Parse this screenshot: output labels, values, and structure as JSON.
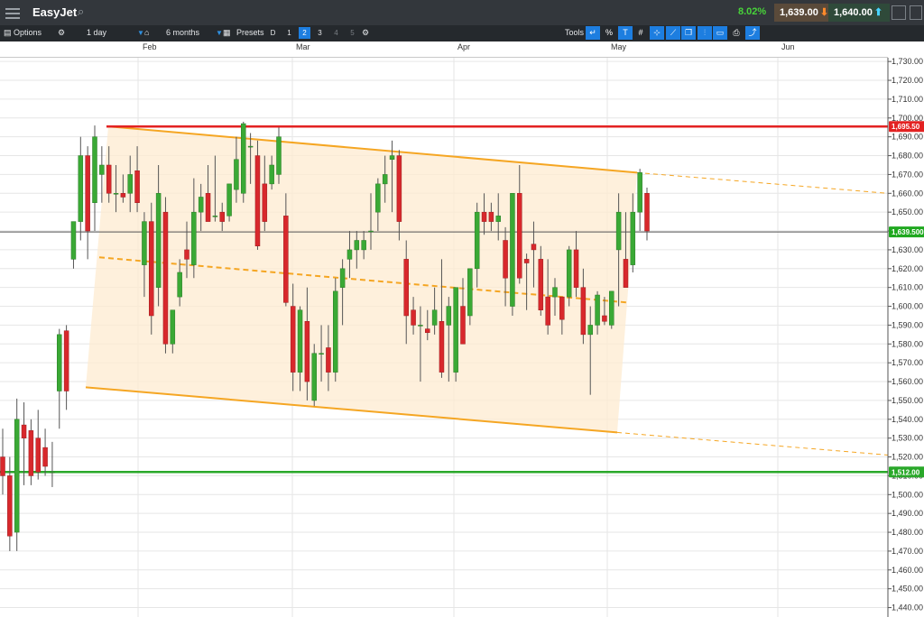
{
  "header": {
    "title": "EasyJet",
    "change": "8.02%",
    "sell_price": "1,639.00",
    "buy_price": "1,640.00"
  },
  "toolbar": {
    "options_label": "Options",
    "interval": "1 day",
    "range": "6 months",
    "presets_label": "Presets",
    "presets": [
      "D",
      "1",
      "2",
      "3",
      "4",
      "5"
    ],
    "active_preset": "2",
    "tools_label": "Tools"
  },
  "colors": {
    "up": "#3aa935",
    "down": "#d8282c",
    "resistance": "#e32222",
    "support": "#2aa82a",
    "channel": "#f5a623",
    "channel_fill": "#fdebd0",
    "current_price": "#1fa81f"
  },
  "chart_data": {
    "type": "candlestick",
    "x_labels": [
      "Feb",
      "Mar",
      "Apr",
      "May",
      "Jun"
    ],
    "ylim": [
      1435,
      1732
    ],
    "y_ticks": [
      1440,
      1450,
      1460,
      1470,
      1480,
      1490,
      1500,
      1510,
      1520,
      1530,
      1540,
      1550,
      1560,
      1570,
      1580,
      1590,
      1600,
      1610,
      1620,
      1630,
      1640,
      1650,
      1660,
      1670,
      1680,
      1690,
      1700,
      1710,
      1720,
      1730
    ],
    "grid": true,
    "resistance": {
      "value": 1695.5,
      "label": "1,695.50"
    },
    "support": {
      "value": 1512.0,
      "label": "1,512.00"
    },
    "current_price": {
      "value": 1639.5,
      "label": "1,639.500"
    },
    "channel": {
      "upper": [
        1695.5,
        1671
      ],
      "middle": [
        1626,
        1602
      ],
      "lower": [
        1557,
        1533
      ],
      "extension_upper": 1660,
      "extension_lower": 1521
    },
    "candles": [
      {
        "o": 1520,
        "h": 1535,
        "l": 1500,
        "c": 1510
      },
      {
        "o": 1510,
        "h": 1520,
        "l": 1470,
        "c": 1478
      },
      {
        "o": 1480,
        "h": 1551,
        "l": 1470,
        "c": 1540
      },
      {
        "o": 1537,
        "h": 1549,
        "l": 1505,
        "c": 1530
      },
      {
        "o": 1534,
        "h": 1540,
        "l": 1505,
        "c": 1510
      },
      {
        "o": 1530,
        "h": 1545,
        "l": 1508,
        "c": 1512
      },
      {
        "o": 1525,
        "h": 1535,
        "l": 1510,
        "c": 1515
      },
      {
        "o": 1512,
        "h": 1528,
        "l": 1504,
        "c": 1512
      },
      {
        "o": 1555,
        "h": 1588,
        "l": 1535,
        "c": 1585
      },
      {
        "o": 1587,
        "h": 1590,
        "l": 1545,
        "c": 1555
      },
      {
        "o": 1625,
        "h": 1645,
        "l": 1620,
        "c": 1645
      },
      {
        "o": 1645,
        "h": 1690,
        "l": 1635,
        "c": 1680
      },
      {
        "o": 1680,
        "h": 1685,
        "l": 1625,
        "c": 1640
      },
      {
        "o": 1655,
        "h": 1696,
        "l": 1640,
        "c": 1690
      },
      {
        "o": 1670,
        "h": 1685,
        "l": 1655,
        "c": 1675
      },
      {
        "o": 1675,
        "h": 1685,
        "l": 1655,
        "c": 1660
      },
      {
        "o": 1660,
        "h": 1675,
        "l": 1650,
        "c": 1660
      },
      {
        "o": 1660,
        "h": 1670,
        "l": 1655,
        "c": 1658
      },
      {
        "o": 1660,
        "h": 1680,
        "l": 1650,
        "c": 1670
      },
      {
        "o": 1672,
        "h": 1685,
        "l": 1650,
        "c": 1655
      },
      {
        "o": 1622,
        "h": 1650,
        "l": 1605,
        "c": 1645
      },
      {
        "o": 1645,
        "h": 1655,
        "l": 1585,
        "c": 1595
      },
      {
        "o": 1610,
        "h": 1675,
        "l": 1600,
        "c": 1660
      },
      {
        "o": 1650,
        "h": 1658,
        "l": 1575,
        "c": 1580
      },
      {
        "o": 1580,
        "h": 1598,
        "l": 1575,
        "c": 1598
      },
      {
        "o": 1605,
        "h": 1625,
        "l": 1600,
        "c": 1618
      },
      {
        "o": 1630,
        "h": 1645,
        "l": 1615,
        "c": 1625
      },
      {
        "o": 1622,
        "h": 1668,
        "l": 1615,
        "c": 1650
      },
      {
        "o": 1650,
        "h": 1665,
        "l": 1640,
        "c": 1658
      },
      {
        "o": 1660,
        "h": 1675,
        "l": 1645,
        "c": 1645
      },
      {
        "o": 1648,
        "h": 1680,
        "l": 1645,
        "c": 1648
      },
      {
        "o": 1650,
        "h": 1655,
        "l": 1640,
        "c": 1645
      },
      {
        "o": 1648,
        "h": 1665,
        "l": 1645,
        "c": 1665
      },
      {
        "o": 1662,
        "h": 1690,
        "l": 1655,
        "c": 1678
      },
      {
        "o": 1660,
        "h": 1698,
        "l": 1655,
        "c": 1697
      },
      {
        "o": 1685,
        "h": 1692,
        "l": 1665,
        "c": 1685
      },
      {
        "o": 1680,
        "h": 1688,
        "l": 1630,
        "c": 1632
      },
      {
        "o": 1665,
        "h": 1680,
        "l": 1640,
        "c": 1645
      },
      {
        "o": 1665,
        "h": 1680,
        "l": 1662,
        "c": 1675
      },
      {
        "o": 1670,
        "h": 1695,
        "l": 1665,
        "c": 1690
      },
      {
        "o": 1648,
        "h": 1660,
        "l": 1600,
        "c": 1602
      },
      {
        "o": 1600,
        "h": 1612,
        "l": 1555,
        "c": 1565
      },
      {
        "o": 1565,
        "h": 1600,
        "l": 1555,
        "c": 1598
      },
      {
        "o": 1592,
        "h": 1610,
        "l": 1550,
        "c": 1560
      },
      {
        "o": 1550,
        "h": 1580,
        "l": 1547,
        "c": 1575
      },
      {
        "o": 1575,
        "h": 1590,
        "l": 1560,
        "c": 1575
      },
      {
        "o": 1578,
        "h": 1590,
        "l": 1555,
        "c": 1565
      },
      {
        "o": 1565,
        "h": 1615,
        "l": 1560,
        "c": 1608
      },
      {
        "o": 1610,
        "h": 1625,
        "l": 1590,
        "c": 1620
      },
      {
        "o": 1625,
        "h": 1640,
        "l": 1615,
        "c": 1630
      },
      {
        "o": 1630,
        "h": 1640,
        "l": 1620,
        "c": 1635
      },
      {
        "o": 1630,
        "h": 1640,
        "l": 1625,
        "c": 1635
      },
      {
        "o": 1640,
        "h": 1660,
        "l": 1630,
        "c": 1640
      },
      {
        "o": 1650,
        "h": 1668,
        "l": 1640,
        "c": 1665
      },
      {
        "o": 1665,
        "h": 1680,
        "l": 1655,
        "c": 1670
      },
      {
        "o": 1678,
        "h": 1688,
        "l": 1650,
        "c": 1680
      },
      {
        "o": 1680,
        "h": 1683,
        "l": 1635,
        "c": 1645
      },
      {
        "o": 1625,
        "h": 1635,
        "l": 1580,
        "c": 1595
      },
      {
        "o": 1598,
        "h": 1605,
        "l": 1585,
        "c": 1590
      },
      {
        "o": 1590,
        "h": 1600,
        "l": 1560,
        "c": 1590
      },
      {
        "o": 1588,
        "h": 1598,
        "l": 1582,
        "c": 1586
      },
      {
        "o": 1590,
        "h": 1610,
        "l": 1585,
        "c": 1598
      },
      {
        "o": 1592,
        "h": 1625,
        "l": 1562,
        "c": 1565
      },
      {
        "o": 1590,
        "h": 1605,
        "l": 1560,
        "c": 1600
      },
      {
        "o": 1565,
        "h": 1610,
        "l": 1560,
        "c": 1610
      },
      {
        "o": 1600,
        "h": 1615,
        "l": 1580,
        "c": 1580
      },
      {
        "o": 1595,
        "h": 1620,
        "l": 1590,
        "c": 1620
      },
      {
        "o": 1620,
        "h": 1655,
        "l": 1610,
        "c": 1650
      },
      {
        "o": 1650,
        "h": 1660,
        "l": 1638,
        "c": 1645
      },
      {
        "o": 1650,
        "h": 1655,
        "l": 1640,
        "c": 1645
      },
      {
        "o": 1645,
        "h": 1660,
        "l": 1635,
        "c": 1648
      },
      {
        "o": 1635,
        "h": 1642,
        "l": 1600,
        "c": 1615
      },
      {
        "o": 1600,
        "h": 1660,
        "l": 1595,
        "c": 1660
      },
      {
        "o": 1660,
        "h": 1675,
        "l": 1612,
        "c": 1615
      },
      {
        "o": 1625,
        "h": 1628,
        "l": 1598,
        "c": 1623
      },
      {
        "o": 1633,
        "h": 1645,
        "l": 1610,
        "c": 1630
      },
      {
        "o": 1625,
        "h": 1632,
        "l": 1595,
        "c": 1598
      },
      {
        "o": 1605,
        "h": 1625,
        "l": 1585,
        "c": 1590
      },
      {
        "o": 1605,
        "h": 1615,
        "l": 1595,
        "c": 1610
      },
      {
        "o": 1605,
        "h": 1605,
        "l": 1585,
        "c": 1593
      },
      {
        "o": 1605,
        "h": 1632,
        "l": 1600,
        "c": 1630
      },
      {
        "o": 1630,
        "h": 1640,
        "l": 1605,
        "c": 1610
      },
      {
        "o": 1610,
        "h": 1620,
        "l": 1580,
        "c": 1585
      },
      {
        "o": 1585,
        "h": 1600,
        "l": 1553,
        "c": 1590
      },
      {
        "o": 1590,
        "h": 1608,
        "l": 1585,
        "c": 1606
      },
      {
        "o": 1595,
        "h": 1605,
        "l": 1590,
        "c": 1592
      },
      {
        "o": 1590,
        "h": 1608,
        "l": 1588,
        "c": 1608
      },
      {
        "o": 1630,
        "h": 1660,
        "l": 1600,
        "c": 1650
      },
      {
        "o": 1625,
        "h": 1650,
        "l": 1615,
        "c": 1610
      },
      {
        "o": 1622,
        "h": 1660,
        "l": 1618,
        "c": 1650
      },
      {
        "o": 1650,
        "h": 1673,
        "l": 1640,
        "c": 1671
      },
      {
        "o": 1660,
        "h": 1663,
        "l": 1635,
        "c": 1640
      }
    ]
  }
}
